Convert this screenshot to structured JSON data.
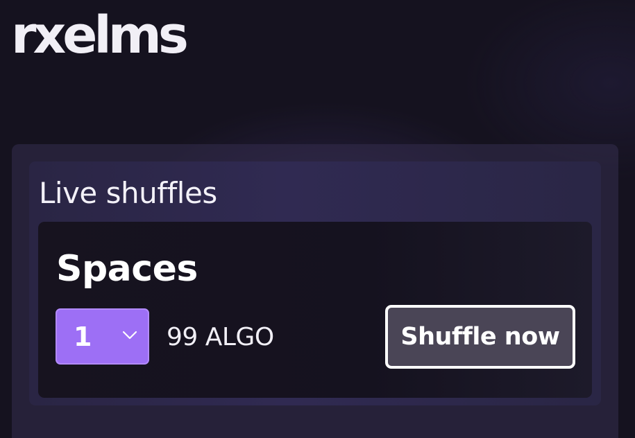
{
  "brand": {
    "logo_text": "rxelms"
  },
  "live_shuffles": {
    "title": "Live shuffles",
    "items": [
      {
        "name": "Spaces",
        "quantity": "1",
        "price": "99 ALGO",
        "action_label": "Shuffle now"
      }
    ]
  },
  "colors": {
    "background": "#15121f",
    "accent": "#9d6ff5",
    "button_bg": "#4a4556",
    "button_border": "#ffffff"
  }
}
